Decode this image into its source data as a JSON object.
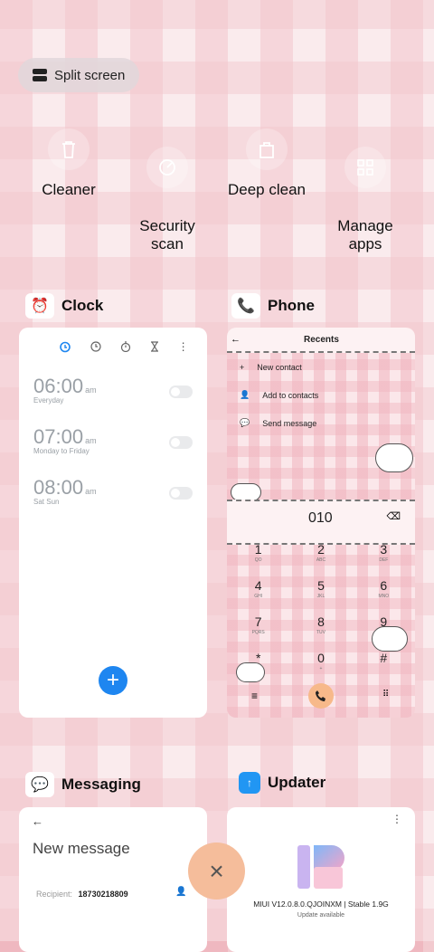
{
  "split_screen": {
    "label": "Split screen"
  },
  "tools": [
    {
      "label": "Cleaner",
      "icon": "trash-icon"
    },
    {
      "label": "Security\nscan",
      "icon": "shield-scan-icon"
    },
    {
      "label": "Deep clean",
      "icon": "bag-icon"
    },
    {
      "label": "Manage\napps",
      "icon": "grid-icon"
    }
  ],
  "apps": {
    "clock": {
      "name": "Clock",
      "alarms": [
        {
          "time": "06:00",
          "ampm": "am",
          "repeat": "Everyday"
        },
        {
          "time": "07:00",
          "ampm": "am",
          "repeat": "Monday to Friday"
        },
        {
          "time": "08:00",
          "ampm": "am",
          "repeat": "Sat Sun"
        }
      ],
      "fab": "+"
    },
    "phone": {
      "name": "Phone",
      "title": "Recents",
      "menu": [
        "New contact",
        "Add to contacts",
        "Send message"
      ],
      "number": "010",
      "keys": [
        {
          "d": "1",
          "l": "QO"
        },
        {
          "d": "2",
          "l": "ABC"
        },
        {
          "d": "3",
          "l": "DEF"
        },
        {
          "d": "4",
          "l": "GHI"
        },
        {
          "d": "5",
          "l": "JKL"
        },
        {
          "d": "6",
          "l": "MNO"
        },
        {
          "d": "7",
          "l": "PQRS"
        },
        {
          "d": "8",
          "l": "TUV"
        },
        {
          "d": "9",
          "l": "WXYZ"
        },
        {
          "d": "*",
          "l": ""
        },
        {
          "d": "0",
          "l": "+"
        },
        {
          "d": "#",
          "l": ""
        }
      ]
    },
    "messaging": {
      "name": "Messaging",
      "title": "New message",
      "recipient_label": "Recipient:",
      "recipient_value": "18730218809"
    },
    "updater": {
      "name": "Updater",
      "version": "MIUI V12.0.8.0.QJOINXM | Stable 1.9G",
      "status": "Update available"
    }
  },
  "close": {
    "label": "×"
  }
}
